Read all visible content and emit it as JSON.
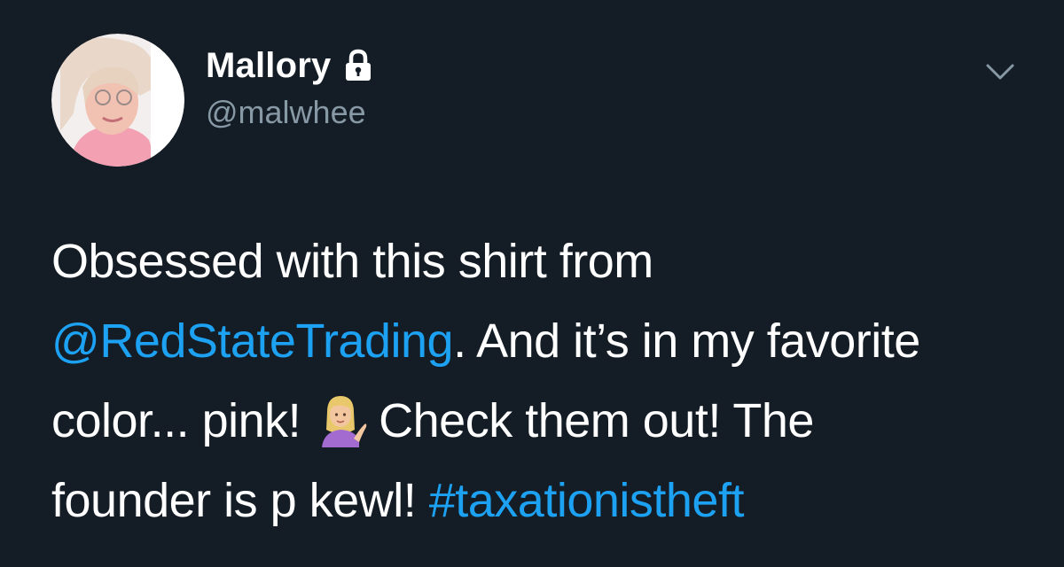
{
  "tweet": {
    "author": {
      "display_name": "Mallory",
      "handle": "@malwhee",
      "protected_icon": "lock-icon",
      "avatar_icon": "profile-photo"
    },
    "menu_icon": "chevron-down-icon",
    "text": {
      "line1": "Obsessed with this shirt from",
      "mention": "@RedStateTrading",
      "line2_rest": ". And it’s in my favorite",
      "line3_a": "color... pink!",
      "emoji": "information-desk-person-emoji",
      "line3_b": "Check them out! The",
      "line4_a": "founder is p kewl!",
      "hashtag": "#taxationistheft"
    }
  },
  "colors": {
    "background": "#141d26",
    "link": "#1da1f2",
    "secondary_text": "#8899a6",
    "primary_text": "#ffffff"
  }
}
